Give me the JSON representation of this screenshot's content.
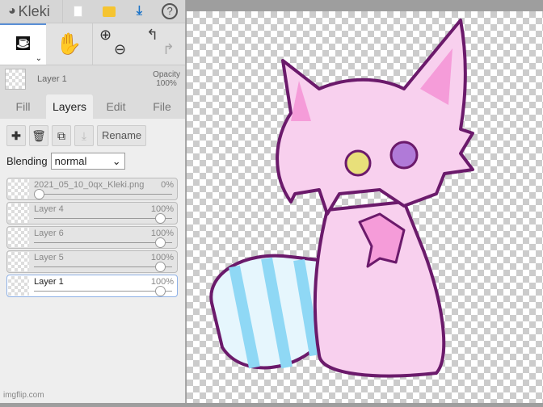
{
  "app": {
    "name": "Kleki"
  },
  "topbar": {
    "new": "new-file",
    "open": "open-file",
    "save": "download",
    "help": "?"
  },
  "current_layer": {
    "name": "Layer 1",
    "opacity_label": "Opacity",
    "opacity": "100%"
  },
  "tabs": [
    "Fill",
    "Layers",
    "Edit",
    "File"
  ],
  "layer_buttons": {
    "rename": "Rename"
  },
  "blending": {
    "label": "Blending",
    "value": "normal"
  },
  "layers": [
    {
      "name": "2021_05_10_0qx_Kleki.png",
      "opacity": "0%",
      "value": 0
    },
    {
      "name": "Layer 4",
      "opacity": "100%",
      "value": 100
    },
    {
      "name": "Layer 6",
      "opacity": "100%",
      "value": 100
    },
    {
      "name": "Layer 5",
      "opacity": "100%",
      "value": 100
    },
    {
      "name": "Layer 1",
      "opacity": "100%",
      "value": 100
    }
  ],
  "watermark": "imgflip.com",
  "colors": {
    "accent": "#1a73c8",
    "outline": "#6b1a6b",
    "pink": "#f8d0ee",
    "blue": "#8fd8f5"
  }
}
